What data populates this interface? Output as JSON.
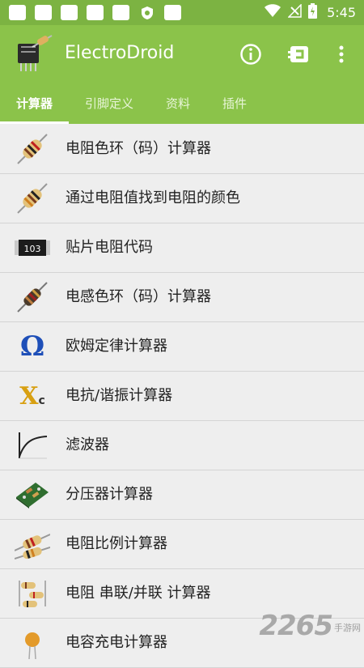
{
  "status_bar": {
    "time": "5:45"
  },
  "app": {
    "title": "ElectroDroid"
  },
  "tabs": [
    {
      "label": "计算器",
      "active": true
    },
    {
      "label": "引脚定义",
      "active": false
    },
    {
      "label": "资料",
      "active": false
    },
    {
      "label": "插件",
      "active": false
    }
  ],
  "items": [
    {
      "label": "电阻色环（码）计算器",
      "icon": "resistor-icon"
    },
    {
      "label": "通过电阻值找到电阻的颜色",
      "icon": "resistor-icon"
    },
    {
      "label": "贴片电阻代码",
      "icon": "smd-resistor-icon",
      "icon_text": "103"
    },
    {
      "label": "电感色环（码）计算器",
      "icon": "inductor-icon"
    },
    {
      "label": "欧姆定律计算器",
      "icon": "omega-icon",
      "icon_text": "Ω"
    },
    {
      "label": "电抗/谐振计算器",
      "icon": "reactance-icon",
      "icon_text": "X",
      "icon_sub": "c"
    },
    {
      "label": "滤波器",
      "icon": "filter-curve-icon"
    },
    {
      "label": "分压器计算器",
      "icon": "circuit-board-icon"
    },
    {
      "label": "电阻比例计算器",
      "icon": "resistor-ratio-icon"
    },
    {
      "label": "电阻 串联/并联 计算器",
      "icon": "resistor-network-icon"
    },
    {
      "label": "电容充电计算器",
      "icon": "capacitor-icon"
    }
  ],
  "watermark": {
    "number": "2265",
    "text": "手游网"
  },
  "colors": {
    "primary": "#8bc34a",
    "status_bar": "#7cb342",
    "background": "#eeeeee"
  }
}
